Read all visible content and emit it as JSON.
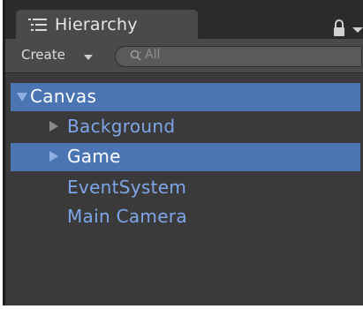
{
  "window": {
    "tab_title": "Hierarchy",
    "tab_icon": "hierarchy-list-icon",
    "lock_icon": "lock-icon",
    "menu_icon": "context-menu-icon"
  },
  "toolbar": {
    "create_label": "Create",
    "create_arrow_icon": "dropdown-arrow-icon",
    "search_placeholder": "All",
    "search_icon": "search-icon"
  },
  "tree": {
    "items": [
      {
        "label": "Canvas",
        "depth": 0,
        "expanded": true,
        "has_children": true,
        "selected": true
      },
      {
        "label": "Background",
        "depth": 1,
        "expanded": false,
        "has_children": true,
        "selected": false
      },
      {
        "label": "Game",
        "depth": 1,
        "expanded": false,
        "has_children": true,
        "selected": true
      },
      {
        "label": "EventSystem",
        "depth": 1,
        "expanded": false,
        "has_children": false,
        "selected": false
      },
      {
        "label": "Main Camera",
        "depth": 1,
        "expanded": false,
        "has_children": false,
        "selected": false
      }
    ]
  },
  "colors": {
    "selection": "#4b74b3",
    "item_text": "#7ea6ea",
    "panel_bg": "#3a3a3a",
    "toolbar_bg": "#4a4a4a"
  }
}
